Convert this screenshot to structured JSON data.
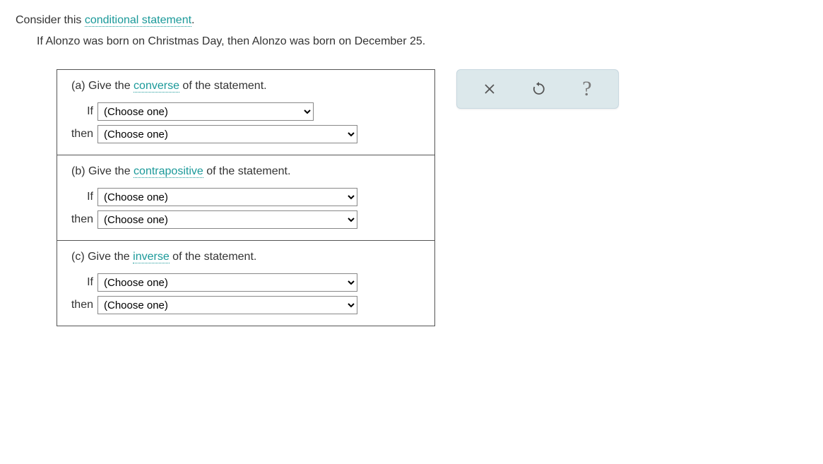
{
  "intro": {
    "prefix": "Consider this ",
    "link": "conditional statement",
    "suffix": "."
  },
  "statement": "If Alonzo was born on Christmas Day, then Alonzo was born on December 25.",
  "parts": {
    "a": {
      "label": "(a)",
      "before": " Give the ",
      "term": "converse",
      "after": " of the statement."
    },
    "b": {
      "label": "(b)",
      "before": " Give the ",
      "term": "contrapositive",
      "after": " of the statement."
    },
    "c": {
      "label": "(c)",
      "before": " Give the ",
      "term": "inverse",
      "after": " of the statement."
    }
  },
  "labels": {
    "if": "If",
    "then": "then"
  },
  "select_placeholder": "(Choose one)",
  "toolbar": {
    "close": "close",
    "reset": "reset",
    "help": "help"
  }
}
